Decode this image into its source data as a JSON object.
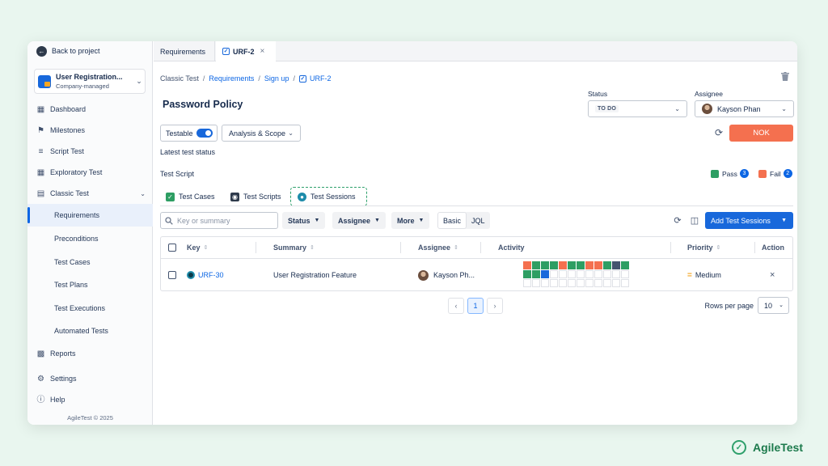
{
  "sidebar": {
    "back_label": "Back to project",
    "project": {
      "name": "User Registration...",
      "type": "Company-managed"
    },
    "items": [
      {
        "label": "Dashboard",
        "icon": "dashboard-icon"
      },
      {
        "label": "Milestones",
        "icon": "flag-icon"
      },
      {
        "label": "Script Test",
        "icon": "script-icon"
      },
      {
        "label": "Exploratory Test",
        "icon": "grid-icon"
      },
      {
        "label": "Classic Test",
        "icon": "table-icon"
      }
    ],
    "sub_items": [
      "Requirements",
      "Preconditions",
      "Test Cases",
      "Test Plans",
      "Test Executions",
      "Automated Tests"
    ],
    "active_sub_item": "Requirements",
    "bottom_items": [
      {
        "label": "Reports",
        "icon": "chart-icon"
      },
      {
        "label": "Settings",
        "icon": "gear-icon"
      },
      {
        "label": "Help",
        "icon": "help-icon"
      }
    ],
    "copyright": "AgileTest © 2025"
  },
  "tabs": [
    {
      "label": "Requirements"
    },
    {
      "label": "URF-2"
    }
  ],
  "breadcrumb": [
    "Classic Test",
    "Requirements",
    "Sign up",
    "URF-2"
  ],
  "page_title": "Password Policy",
  "status": {
    "label": "Status",
    "value": "TO DO"
  },
  "assignee": {
    "label": "Assignee",
    "value": "Kayson Phan"
  },
  "testable_label": "Testable",
  "testable_on": true,
  "analysis_label": "Analysis & Scope",
  "nok_label": "NOK",
  "latest_status_label": "Latest test status",
  "test_script_label": "Test Script",
  "legend": {
    "pass": {
      "label": "Pass",
      "count": "3",
      "color": "#2e9e63"
    },
    "fail": {
      "label": "Fail",
      "count": "2",
      "color": "#f4704f"
    }
  },
  "sub_tabs": [
    "Test Cases",
    "Test Scripts",
    "Test Sessions"
  ],
  "active_sub_tab": "Test Sessions",
  "toolbar": {
    "search_placeholder": "Key or summary",
    "filters": [
      "Status",
      "Assignee",
      "More"
    ],
    "mode_basic": "Basic",
    "mode_jql": "JQL",
    "add_label": "Add Test Sessions"
  },
  "table": {
    "columns": [
      "Key",
      "Summary",
      "Assignee",
      "Activity",
      "Priority",
      "Action"
    ],
    "rows": [
      {
        "key": "URF-30",
        "summary": "User Registration Feature",
        "assignee": "Kayson Ph...",
        "priority": "Medium",
        "activity": [
          "fail",
          "pass",
          "pass",
          "pass",
          "fail",
          "pass",
          "pass",
          "fail",
          "fail",
          "pass",
          "dark",
          "pass",
          "pass",
          "pass",
          "blue",
          "empty",
          "empty",
          "empty",
          "empty",
          "empty",
          "empty",
          "empty",
          "empty",
          "empty",
          "empty",
          "empty",
          "empty",
          "empty",
          "empty",
          "empty",
          "empty",
          "empty",
          "empty",
          "empty",
          "empty",
          "empty"
        ]
      }
    ]
  },
  "activity_colors": {
    "pass": "#2e9e63",
    "fail": "#f4704f",
    "blue": "#1868db",
    "dark": "#44546f",
    "empty": "#ffffff"
  },
  "pagination": {
    "current": "1",
    "rows_per_page_label": "Rows per page",
    "rows_per_page": "10"
  },
  "brand": "AgileTest"
}
